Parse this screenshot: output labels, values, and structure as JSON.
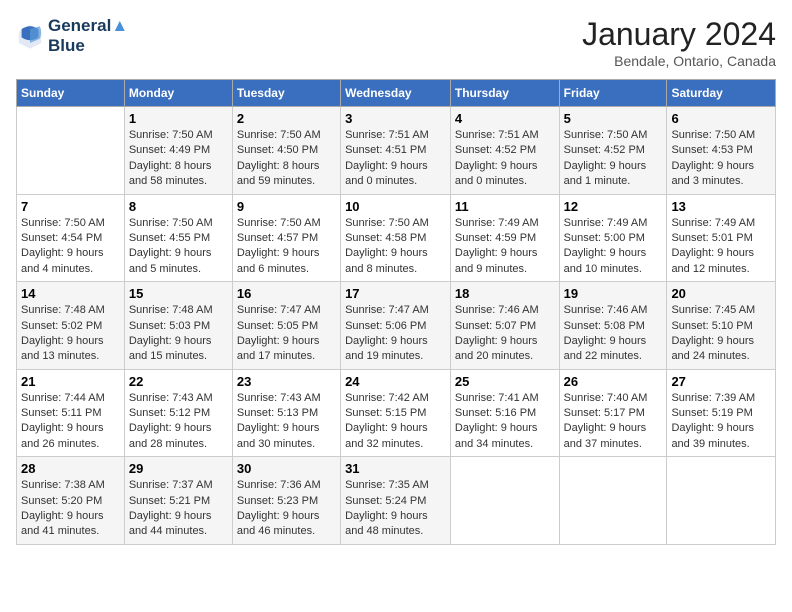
{
  "header": {
    "logo_line1": "General",
    "logo_line2": "Blue",
    "month": "January 2024",
    "location": "Bendale, Ontario, Canada"
  },
  "weekdays": [
    "Sunday",
    "Monday",
    "Tuesday",
    "Wednesday",
    "Thursday",
    "Friday",
    "Saturday"
  ],
  "weeks": [
    [
      {
        "day": "",
        "info": ""
      },
      {
        "day": "1",
        "info": "Sunrise: 7:50 AM\nSunset: 4:49 PM\nDaylight: 8 hours\nand 58 minutes."
      },
      {
        "day": "2",
        "info": "Sunrise: 7:50 AM\nSunset: 4:50 PM\nDaylight: 8 hours\nand 59 minutes."
      },
      {
        "day": "3",
        "info": "Sunrise: 7:51 AM\nSunset: 4:51 PM\nDaylight: 9 hours\nand 0 minutes."
      },
      {
        "day": "4",
        "info": "Sunrise: 7:51 AM\nSunset: 4:52 PM\nDaylight: 9 hours\nand 0 minutes."
      },
      {
        "day": "5",
        "info": "Sunrise: 7:50 AM\nSunset: 4:52 PM\nDaylight: 9 hours\nand 1 minute."
      },
      {
        "day": "6",
        "info": "Sunrise: 7:50 AM\nSunset: 4:53 PM\nDaylight: 9 hours\nand 3 minutes."
      }
    ],
    [
      {
        "day": "7",
        "info": "Sunrise: 7:50 AM\nSunset: 4:54 PM\nDaylight: 9 hours\nand 4 minutes."
      },
      {
        "day": "8",
        "info": "Sunrise: 7:50 AM\nSunset: 4:55 PM\nDaylight: 9 hours\nand 5 minutes."
      },
      {
        "day": "9",
        "info": "Sunrise: 7:50 AM\nSunset: 4:57 PM\nDaylight: 9 hours\nand 6 minutes."
      },
      {
        "day": "10",
        "info": "Sunrise: 7:50 AM\nSunset: 4:58 PM\nDaylight: 9 hours\nand 8 minutes."
      },
      {
        "day": "11",
        "info": "Sunrise: 7:49 AM\nSunset: 4:59 PM\nDaylight: 9 hours\nand 9 minutes."
      },
      {
        "day": "12",
        "info": "Sunrise: 7:49 AM\nSunset: 5:00 PM\nDaylight: 9 hours\nand 10 minutes."
      },
      {
        "day": "13",
        "info": "Sunrise: 7:49 AM\nSunset: 5:01 PM\nDaylight: 9 hours\nand 12 minutes."
      }
    ],
    [
      {
        "day": "14",
        "info": "Sunrise: 7:48 AM\nSunset: 5:02 PM\nDaylight: 9 hours\nand 13 minutes."
      },
      {
        "day": "15",
        "info": "Sunrise: 7:48 AM\nSunset: 5:03 PM\nDaylight: 9 hours\nand 15 minutes."
      },
      {
        "day": "16",
        "info": "Sunrise: 7:47 AM\nSunset: 5:05 PM\nDaylight: 9 hours\nand 17 minutes."
      },
      {
        "day": "17",
        "info": "Sunrise: 7:47 AM\nSunset: 5:06 PM\nDaylight: 9 hours\nand 19 minutes."
      },
      {
        "day": "18",
        "info": "Sunrise: 7:46 AM\nSunset: 5:07 PM\nDaylight: 9 hours\nand 20 minutes."
      },
      {
        "day": "19",
        "info": "Sunrise: 7:46 AM\nSunset: 5:08 PM\nDaylight: 9 hours\nand 22 minutes."
      },
      {
        "day": "20",
        "info": "Sunrise: 7:45 AM\nSunset: 5:10 PM\nDaylight: 9 hours\nand 24 minutes."
      }
    ],
    [
      {
        "day": "21",
        "info": "Sunrise: 7:44 AM\nSunset: 5:11 PM\nDaylight: 9 hours\nand 26 minutes."
      },
      {
        "day": "22",
        "info": "Sunrise: 7:43 AM\nSunset: 5:12 PM\nDaylight: 9 hours\nand 28 minutes."
      },
      {
        "day": "23",
        "info": "Sunrise: 7:43 AM\nSunset: 5:13 PM\nDaylight: 9 hours\nand 30 minutes."
      },
      {
        "day": "24",
        "info": "Sunrise: 7:42 AM\nSunset: 5:15 PM\nDaylight: 9 hours\nand 32 minutes."
      },
      {
        "day": "25",
        "info": "Sunrise: 7:41 AM\nSunset: 5:16 PM\nDaylight: 9 hours\nand 34 minutes."
      },
      {
        "day": "26",
        "info": "Sunrise: 7:40 AM\nSunset: 5:17 PM\nDaylight: 9 hours\nand 37 minutes."
      },
      {
        "day": "27",
        "info": "Sunrise: 7:39 AM\nSunset: 5:19 PM\nDaylight: 9 hours\nand 39 minutes."
      }
    ],
    [
      {
        "day": "28",
        "info": "Sunrise: 7:38 AM\nSunset: 5:20 PM\nDaylight: 9 hours\nand 41 minutes."
      },
      {
        "day": "29",
        "info": "Sunrise: 7:37 AM\nSunset: 5:21 PM\nDaylight: 9 hours\nand 44 minutes."
      },
      {
        "day": "30",
        "info": "Sunrise: 7:36 AM\nSunset: 5:23 PM\nDaylight: 9 hours\nand 46 minutes."
      },
      {
        "day": "31",
        "info": "Sunrise: 7:35 AM\nSunset: 5:24 PM\nDaylight: 9 hours\nand 48 minutes."
      },
      {
        "day": "",
        "info": ""
      },
      {
        "day": "",
        "info": ""
      },
      {
        "day": "",
        "info": ""
      }
    ]
  ]
}
